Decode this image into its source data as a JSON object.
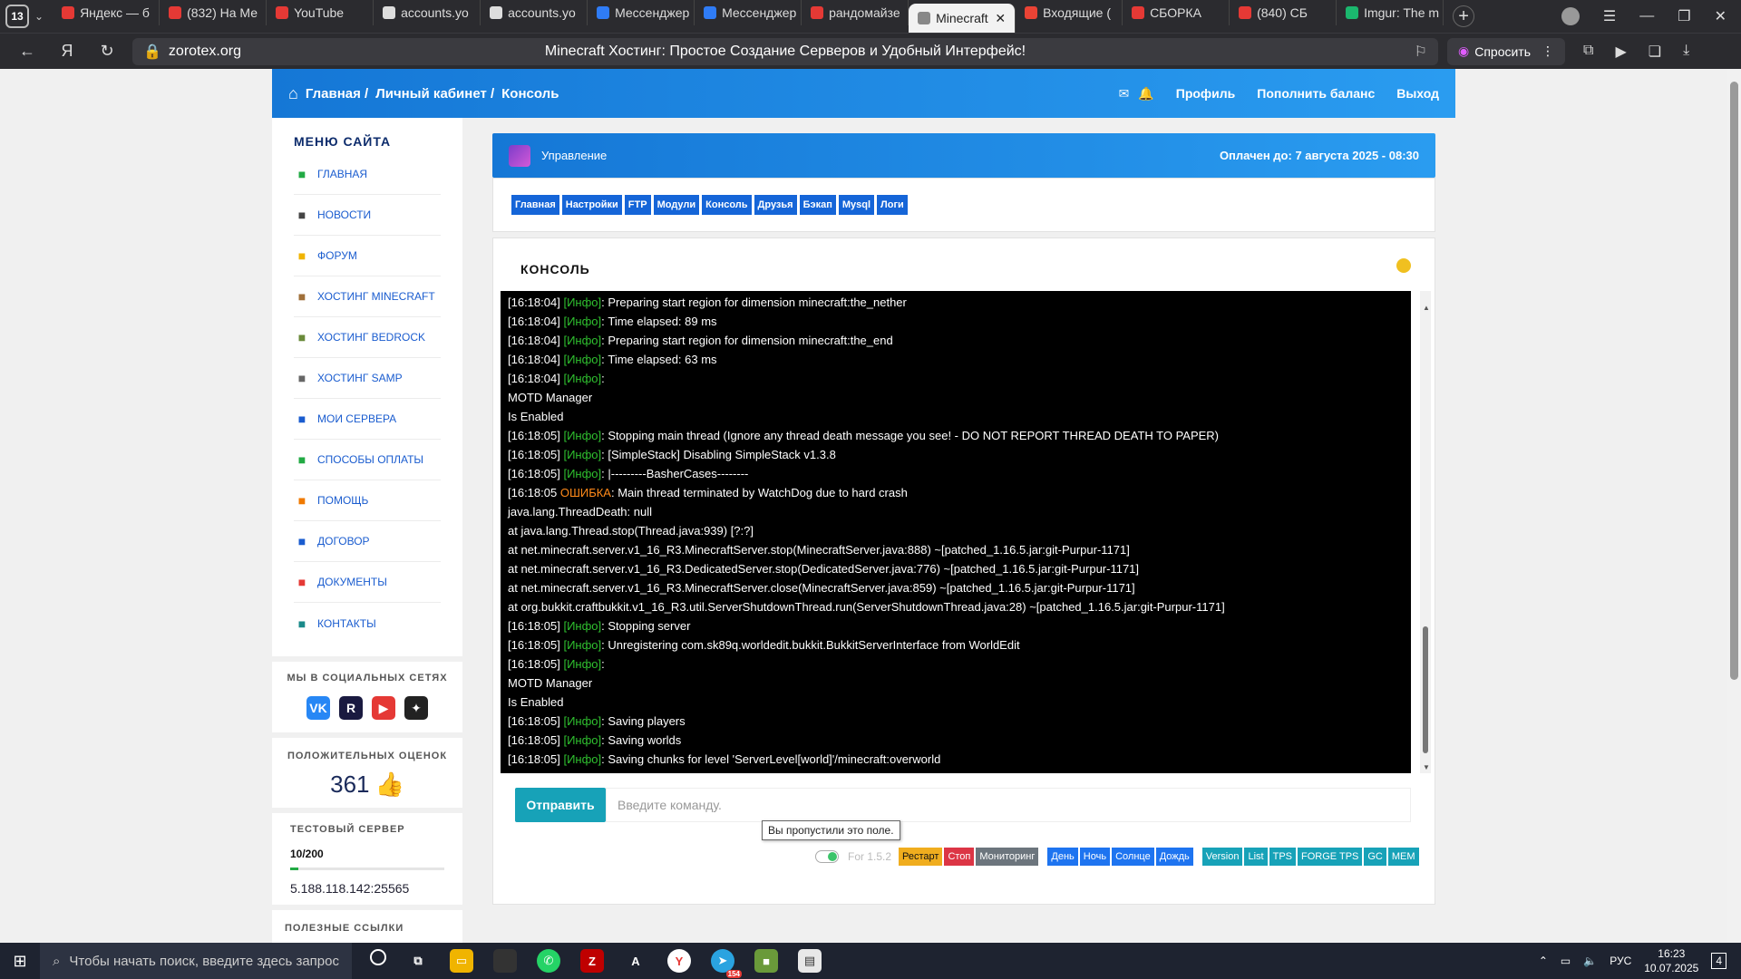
{
  "browser": {
    "tab_count": "13",
    "tabs": [
      {
        "label": "Яндекс — б",
        "color": "#e53935"
      },
      {
        "label": "(832) На Ме",
        "color": "#e53935"
      },
      {
        "label": "YouTube",
        "color": "#e53935"
      },
      {
        "label": "accounts.yo",
        "color": "#dddddd"
      },
      {
        "label": "accounts.yo",
        "color": "#dddddd"
      },
      {
        "label": "Мессенджер",
        "color": "#2f7cf6"
      },
      {
        "label": "Мессенджер",
        "color": "#2f7cf6"
      },
      {
        "label": "рандомайзе",
        "color": "#e53935"
      },
      {
        "label": "Minecraft",
        "color": "#888888"
      },
      {
        "label": "Входящие (",
        "color": "#ea4335"
      },
      {
        "label": "СБОРКА",
        "color": "#e53935"
      },
      {
        "label": "(840) СБ",
        "color": "#e53935"
      },
      {
        "label": "Imgur: The m",
        "color": "#1bb76e"
      }
    ],
    "url": "zorotex.org",
    "page_title": "Minecraft Хостинг: Простое Создание Серверов и Удобный Интерфейс!",
    "ask_label": "Спросить"
  },
  "header": {
    "crumbs": [
      "Главная /",
      "Личный кабинет /",
      "Консоль"
    ],
    "profile": "Профиль",
    "topup": "Пополнить баланс",
    "logout": "Выход"
  },
  "sidebar": {
    "title": "МЕНЮ САЙТА",
    "items": [
      {
        "label": "ГЛАВНАЯ",
        "color": "#22aa44",
        "icon": "home-icon"
      },
      {
        "label": "НОВОСТИ",
        "color": "#444444",
        "icon": "news-icon"
      },
      {
        "label": "ФОРУМ",
        "color": "#f0b400",
        "icon": "forum-icon"
      },
      {
        "label": "ХОСТИНГ MINECRAFT",
        "color": "#a0703a",
        "icon": "bucket-icon"
      },
      {
        "label": "ХОСТИНГ BEDROCK",
        "color": "#6a8a3a",
        "icon": "grass-block-icon"
      },
      {
        "label": "ХОСТИНГ SAMP",
        "color": "#666666",
        "icon": "wheel-icon"
      },
      {
        "label": "МОИ СЕРВЕРА",
        "color": "#1a5ccf",
        "icon": "servers-icon"
      },
      {
        "label": "СПОСОБЫ ОПЛАТЫ",
        "color": "#22aa44",
        "icon": "card-icon"
      },
      {
        "label": "ПОМОЩЬ",
        "color": "#f07a00",
        "icon": "help-icon"
      },
      {
        "label": "ДОГОВОР",
        "color": "#1a5ccf",
        "icon": "contract-icon"
      },
      {
        "label": "ДОКУМЕНТЫ",
        "color": "#e53935",
        "icon": "documents-icon"
      },
      {
        "label": "КОНТАКТЫ",
        "color": "#1a8a8a",
        "icon": "contacts-icon"
      }
    ],
    "social_title": "МЫ В СОЦИАЛЬНЫХ СЕТЯХ",
    "socials": [
      {
        "label": "VK",
        "color": "#2787f5",
        "icon": "vk-icon"
      },
      {
        "label": "R",
        "color": "#1a1a40",
        "icon": "rutube-icon"
      },
      {
        "label": "▶",
        "color": "#e53935",
        "icon": "youtube-icon"
      },
      {
        "label": "✦",
        "color": "#222222",
        "icon": "zen-icon"
      }
    ],
    "rating_title": "ПОЛОЖИТЕЛЬНЫХ ОЦЕНОК",
    "rating_value": "361",
    "test_title": "ТЕСТОВЫЙ СЕРВЕР",
    "test_count": "10/200",
    "test_progress": 0.05,
    "test_ip": "5.188.118.142:25565",
    "links_title": "ПОЛЕЗНЫЕ ССЫЛКИ"
  },
  "panel": {
    "title": "Управление",
    "paid_until": "Оплачен до: 7 августа 2025 - 08:30",
    "tabs": [
      "Главная",
      "Настройки",
      "FTP",
      "Модули",
      "Консоль",
      "Друзья",
      "Бэкап",
      "Mysql",
      "Логи"
    ]
  },
  "console": {
    "title": "КОНСОЛЬ",
    "status_color": "#f0c020",
    "lines": [
      {
        "pre": "[16:18:04] ",
        "tag": "[Инфо]",
        "kind": "info",
        "msg": ": Preparing start region for dimension minecraft:the_nether"
      },
      {
        "pre": "[16:18:04] ",
        "tag": "[Инфо]",
        "kind": "info",
        "msg": ": Time elapsed: 89 ms"
      },
      {
        "pre": "[16:18:04] ",
        "tag": "[Инфо]",
        "kind": "info",
        "msg": ": Preparing start region for dimension minecraft:the_end"
      },
      {
        "pre": "[16:18:04] ",
        "tag": "[Инфо]",
        "kind": "info",
        "msg": ": Time elapsed: 63 ms"
      },
      {
        "pre": "[16:18:04] ",
        "tag": "[Инфо]",
        "kind": "info",
        "msg": ":"
      },
      {
        "pre": "MOTD Manager",
        "tag": "",
        "kind": "plain",
        "msg": ""
      },
      {
        "pre": "Is Enabled",
        "tag": "",
        "kind": "plain",
        "msg": ""
      },
      {
        "pre": "[16:18:05] ",
        "tag": "[Инфо]",
        "kind": "info",
        "msg": ": Stopping main thread (Ignore any thread death message you see! - DO NOT REPORT THREAD DEATH TO PAPER)"
      },
      {
        "pre": "[16:18:05] ",
        "tag": "[Инфо]",
        "kind": "info",
        "msg": ": [SimpleStack] Disabling SimpleStack v1.3.8"
      },
      {
        "pre": "[16:18:05] ",
        "tag": "[Инфо]",
        "kind": "info",
        "msg": ": |---------BasherCases--------"
      },
      {
        "pre": "[16:18:05 ",
        "tag": "ОШИБКА",
        "kind": "err",
        "msg": ": Main thread terminated by WatchDog due to hard crash"
      },
      {
        "pre": "java.lang.ThreadDeath: null",
        "tag": "",
        "kind": "plain",
        "msg": ""
      },
      {
        "pre": "at java.lang.Thread.stop(Thread.java:939) [?:?]",
        "tag": "",
        "kind": "plain",
        "msg": ""
      },
      {
        "pre": "at net.minecraft.server.v1_16_R3.MinecraftServer.stop(MinecraftServer.java:888) ~[patched_1.16.5.jar:git-Purpur-1171]",
        "tag": "",
        "kind": "plain",
        "msg": ""
      },
      {
        "pre": "at net.minecraft.server.v1_16_R3.DedicatedServer.stop(DedicatedServer.java:776) ~[patched_1.16.5.jar:git-Purpur-1171]",
        "tag": "",
        "kind": "plain",
        "msg": ""
      },
      {
        "pre": "at net.minecraft.server.v1_16_R3.MinecraftServer.close(MinecraftServer.java:859) ~[patched_1.16.5.jar:git-Purpur-1171]",
        "tag": "",
        "kind": "plain",
        "msg": ""
      },
      {
        "pre": "at org.bukkit.craftbukkit.v1_16_R3.util.ServerShutdownThread.run(ServerShutdownThread.java:28) ~[patched_1.16.5.jar:git-Purpur-1171]",
        "tag": "",
        "kind": "plain",
        "msg": ""
      },
      {
        "pre": "[16:18:05] ",
        "tag": "[Инфо]",
        "kind": "info",
        "msg": ": Stopping server"
      },
      {
        "pre": "[16:18:05] ",
        "tag": "[Инфо]",
        "kind": "info",
        "msg": ": Unregistering com.sk89q.worldedit.bukkit.BukkitServerInterface from WorldEdit"
      },
      {
        "pre": "[16:18:05] ",
        "tag": "[Инфо]",
        "kind": "info",
        "msg": ":"
      },
      {
        "pre": "MOTD Manager",
        "tag": "",
        "kind": "plain",
        "msg": ""
      },
      {
        "pre": "Is Enabled",
        "tag": "",
        "kind": "plain",
        "msg": ""
      },
      {
        "pre": "[16:18:05] ",
        "tag": "[Инфо]",
        "kind": "info",
        "msg": ": Saving players"
      },
      {
        "pre": "[16:18:05] ",
        "tag": "[Инфо]",
        "kind": "info",
        "msg": ": Saving worlds"
      },
      {
        "pre": "[16:18:05] ",
        "tag": "[Инфо]",
        "kind": "info",
        "msg": ": Saving chunks for level 'ServerLevel[world]'/minecraft:overworld"
      }
    ],
    "send_label": "Отправить",
    "input_placeholder": "Введите команду.",
    "tooltip": "Вы пропустили это поле.",
    "version_label": "For 1.5.2",
    "buttons": {
      "restart": "Рестарт",
      "stop": "Стоп",
      "monitor": "Мониторинг",
      "day": "День",
      "night": "Ночь",
      "sun": "Солнце",
      "rain": "Дождь",
      "version": "Version",
      "list": "List",
      "tps": "TPS",
      "forge_tps": "FORGE TPS",
      "gc": "GC",
      "mem": "MEM"
    }
  },
  "taskbar": {
    "search_placeholder": "Чтобы начать поиск, введите здесь запрос",
    "lang": "РУС",
    "time": "16:23",
    "date": "10.07.2025",
    "notif_count": "4",
    "telegram_badge": "154"
  }
}
